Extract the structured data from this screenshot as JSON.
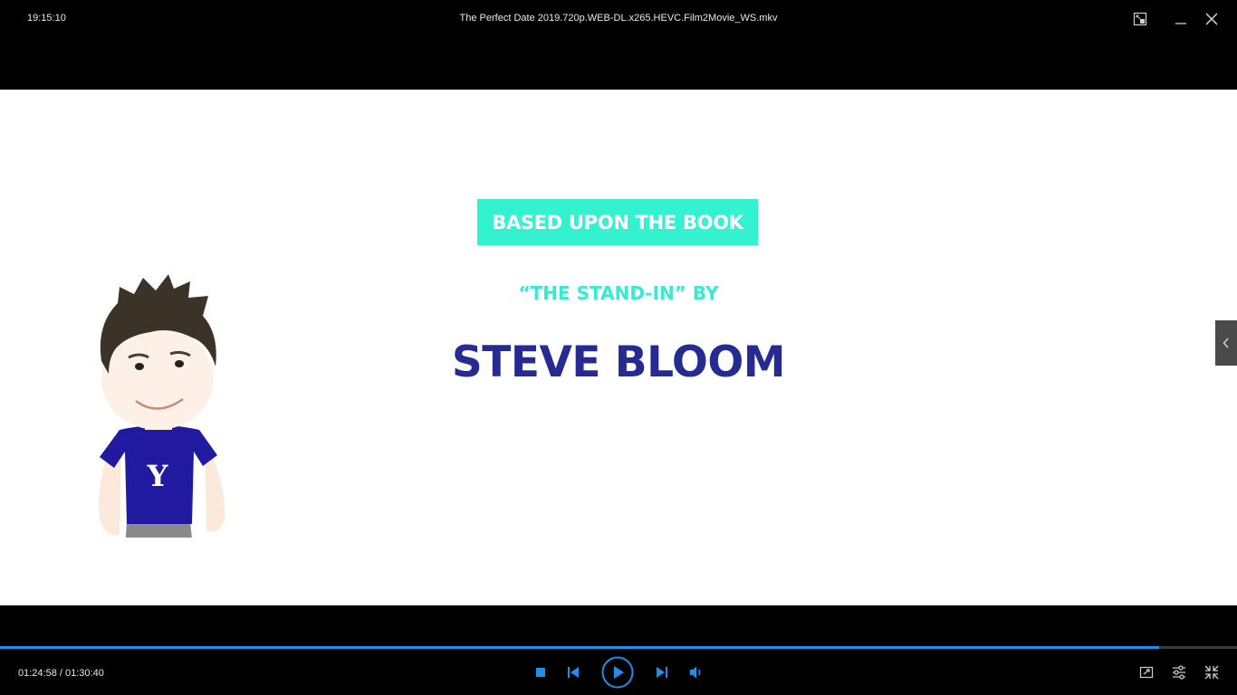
{
  "titlebar": {
    "clock": "19:15:10",
    "file_title": "The Perfect Date 2019.720p.WEB-DL.x265.HEVC.Film2Movie_WS.mkv",
    "icons": {
      "pip": "picture-in-picture-icon",
      "minimize": "minimize-icon",
      "close": "close-icon"
    }
  },
  "video_frame": {
    "badge_text": "BASED UPON THE BOOK",
    "subtitle_text": "“THE STAND-IN” BY",
    "author_text": "STEVE BLOOM",
    "shirt_letter": "Y",
    "colors": {
      "badge_bg": "#33f2cf",
      "subtitle": "#35ecd0",
      "author": "#262a93",
      "shirt": "#1f1aa0"
    }
  },
  "side_panel_handle": {
    "icon": "chevron-left-icon"
  },
  "playback": {
    "current_time": "01:24:58",
    "total_time": "01:30:40",
    "time_display": "01:24:58 / 01:30:40",
    "progress_fraction": 0.937,
    "accent_color": "#1e90e8"
  },
  "controls": {
    "stop": "stop-icon",
    "previous": "skip-previous-icon",
    "play": "play-icon",
    "next": "skip-next-icon",
    "volume": "volume-icon",
    "capture": "screen-capture-icon",
    "settings": "settings-sliders-icon",
    "exit_fullscreen": "exit-fullscreen-icon"
  }
}
